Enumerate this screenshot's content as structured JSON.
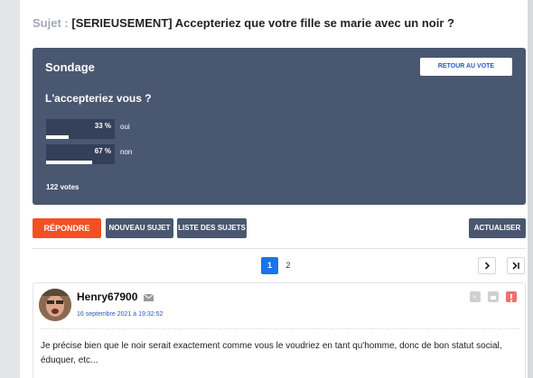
{
  "subject": {
    "prefix": "Sujet :",
    "title": "[SERIEUSEMENT] Accepteriez que votre fille se marie avec un noir ?"
  },
  "poll": {
    "title": "Sondage",
    "back_button": "RETOUR AU VOTE",
    "question": "L'accepteriez vous ?",
    "options": [
      {
        "label": "oui",
        "percent_text": "33 %",
        "fraction": 0.33
      },
      {
        "label": "non",
        "percent_text": "67 %",
        "fraction": 0.67
      }
    ],
    "votes": "122 votes"
  },
  "toolbar": {
    "reply": "RÉPONDRE",
    "new_topic": "NOUVEAU SUJET",
    "topic_list": "LISTE DES SUJETS",
    "update": "ACTUALISER"
  },
  "pagination": {
    "current": "1",
    "next_page": "2",
    "next_icon": "chevron-right-icon",
    "last_icon": "chevron-last-icon"
  },
  "post": {
    "author": "Henry67900",
    "date": "16 septembre 2021 à 19:32:52",
    "body": "Je précise bien que le noir serait exactement comme vous le voudriez en tant qu'homme, donc de bon statut social, éduquer, etc...",
    "icons": [
      "mail-icon",
      "quote-icon",
      "private-message-icon",
      "alert-icon"
    ]
  },
  "colors": {
    "poll_bg": "#4a5770",
    "reply_button": "#f25022",
    "page_active": "#1a73e8",
    "link": "#2a56c6",
    "alert": "#f36e6e"
  }
}
